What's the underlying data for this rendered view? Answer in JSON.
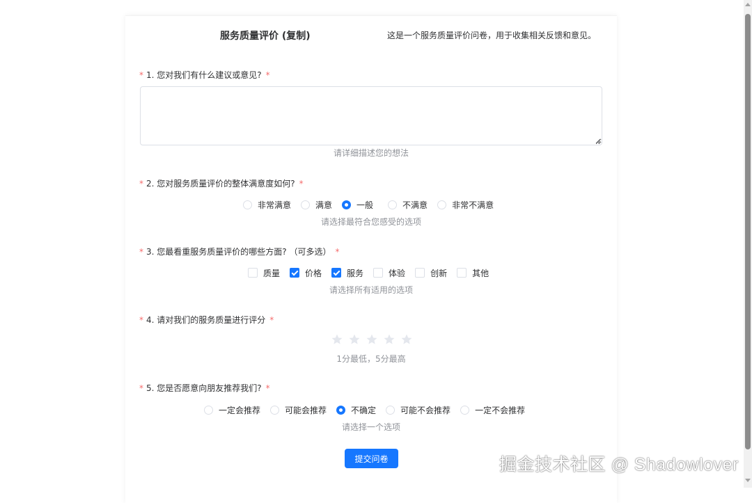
{
  "survey": {
    "title": "服务质量评价 (复制)",
    "description": "这是一个服务质量评价问卷，用于收集相关反馈和意见。"
  },
  "questions": [
    {
      "label": "1. 您对我们有什么建议或意见?",
      "type": "textarea",
      "value": "",
      "hint": "请详细描述您的想法"
    },
    {
      "label": "2. 您对服务质量评价的整体满意度如何?",
      "type": "radio",
      "options": [
        "非常满意",
        "满意",
        "一般",
        "不满意",
        "非常不满意"
      ],
      "selected": "一般",
      "hint": "请选择最符合您感受的选项"
    },
    {
      "label": "3. 您最看重服务质量评价的哪些方面? （可多选）",
      "type": "checkbox",
      "options": [
        "质量",
        "价格",
        "服务",
        "体验",
        "创新",
        "其他"
      ],
      "selected": [
        "价格",
        "服务"
      ],
      "hint": "请选择所有适用的选项"
    },
    {
      "label": "4. 请对我们的服务质量进行评分",
      "type": "rating",
      "max": 5,
      "value": 0,
      "hint": "1分最低，5分最高"
    },
    {
      "label": "5. 您是否愿意向朋友推荐我们?",
      "type": "radio",
      "options": [
        "一定会推荐",
        "可能会推荐",
        "不确定",
        "可能不会推荐",
        "一定不会推荐"
      ],
      "selected": "不确定",
      "hint": "请选择一个选项"
    }
  ],
  "required_mark": "*",
  "submit_label": "提交问卷",
  "watermark": "掘金技术社区 @ Shadowlover",
  "colors": {
    "primary": "#1677ff",
    "required": "#f56c6c",
    "hint": "#909399",
    "text": "#303133",
    "border": "#dcdfe6",
    "star_empty": "#e4e7ed"
  }
}
